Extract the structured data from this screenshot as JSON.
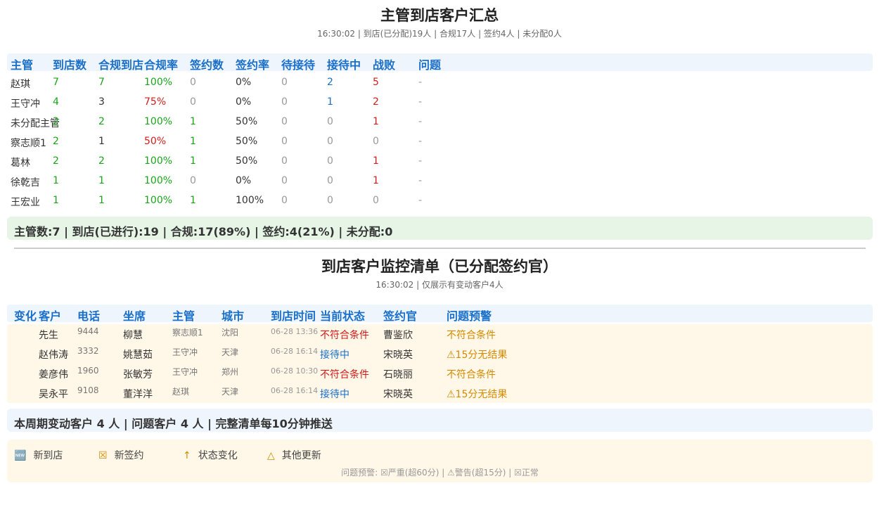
{
  "summary": {
    "title": "主管到店客户汇总",
    "subtitle": "16:30:02 | 到店(已分配)19人 | 合规17人 | 签约4人 | 未分配0人",
    "headers": [
      "主管",
      "到店数",
      "合规到店",
      "合规率",
      "签约数",
      "签约率",
      "待接待",
      "接待中",
      "战败",
      "问题"
    ],
    "rows": [
      [
        "赵琪",
        "7",
        "7",
        "100%",
        "0",
        "0%",
        "0",
        "2",
        "5",
        "-"
      ],
      [
        "王守冲",
        "4",
        "3",
        "75%",
        "0",
        "0%",
        "0",
        "1",
        "2",
        "-"
      ],
      [
        "未分配主管",
        "2",
        "2",
        "100%",
        "1",
        "50%",
        "0",
        "0",
        "1",
        "-"
      ],
      [
        "察志顺1",
        "2",
        "1",
        "50%",
        "1",
        "50%",
        "0",
        "0",
        "0",
        "-"
      ],
      [
        "葛林",
        "2",
        "2",
        "100%",
        "1",
        "50%",
        "0",
        "0",
        "1",
        "-"
      ],
      [
        "徐乾吉",
        "1",
        "1",
        "100%",
        "0",
        "0%",
        "0",
        "0",
        "1",
        "-"
      ],
      [
        "王宏业",
        "1",
        "1",
        "100%",
        "1",
        "100%",
        "0",
        "0",
        "0",
        "-"
      ]
    ],
    "footer": "主管数:7 | 到店(已进行):19 | 合规:17(89%) | 签约:4(21%) | 未分配:0",
    "colors": {
      "header": "#1a6fc9",
      "good": "#1aa51a",
      "bad": "#d21b1b",
      "header_band": "#eef5fd",
      "footer_band": "#e6f5e6"
    }
  },
  "monitor": {
    "title": "到店客户监控清单（已分配签约官）",
    "subtitle": "16:30:02 | 仅展示有变动客户4人",
    "headers": [
      "变化",
      "客户",
      "电话",
      "坐席",
      "主管",
      "城市",
      "到店时间",
      "当前状态",
      "签约官",
      "问题预警"
    ],
    "rows": [
      {
        "change": "",
        "customer": "先生",
        "phone": "9444",
        "seat": "柳慧",
        "manager": "察志顺1",
        "city": "沈阳",
        "time": "06-28 13:36",
        "status": "不符合条件",
        "status_type": "bad",
        "officer": "曹鉴欣",
        "warning": "不符合条件"
      },
      {
        "change": "",
        "customer": "赵伟涛",
        "phone": "3332",
        "seat": "姚慧茹",
        "manager": "王守冲",
        "city": "天津",
        "time": "06-28 16:14",
        "status": "接待中",
        "status_type": "active",
        "officer": "宋晓英",
        "warning": "⚠15分无结果"
      },
      {
        "change": "",
        "customer": "姜彦伟",
        "phone": "1960",
        "seat": "张敏芳",
        "manager": "王守冲",
        "city": "郑州",
        "time": "06-28 10:30",
        "status": "不符合条件",
        "status_type": "bad",
        "officer": "石晓丽",
        "warning": "不符合条件"
      },
      {
        "change": "",
        "customer": "吴永平",
        "phone": "9108",
        "seat": "董洋洋",
        "manager": "赵琪",
        "city": "天津",
        "time": "06-28 16:14",
        "status": "接待中",
        "status_type": "active",
        "officer": "宋晓英",
        "warning": "⚠15分无结果"
      }
    ],
    "footer": "本周期变动客户 4 人 | 问题客户 4 人 | 完整清单每10分钟推送",
    "colors": {
      "warning": "#d48a00",
      "row_band": "#fff7e8",
      "footer_band": "#eef5fd"
    }
  },
  "legend": {
    "items": [
      {
        "icon": "new-icon",
        "glyph": "🆕",
        "label": "新到店"
      },
      {
        "icon": "contract-icon",
        "glyph": "☒",
        "label": "新签约"
      },
      {
        "icon": "arrow-up-icon",
        "glyph": "↑",
        "label": "状态变化"
      },
      {
        "icon": "triangle-icon",
        "glyph": "△",
        "label": "其他更新"
      }
    ],
    "note": "问题预警: ☒严重(超60分) | ⚠警告(超15分) | ☒正常"
  }
}
